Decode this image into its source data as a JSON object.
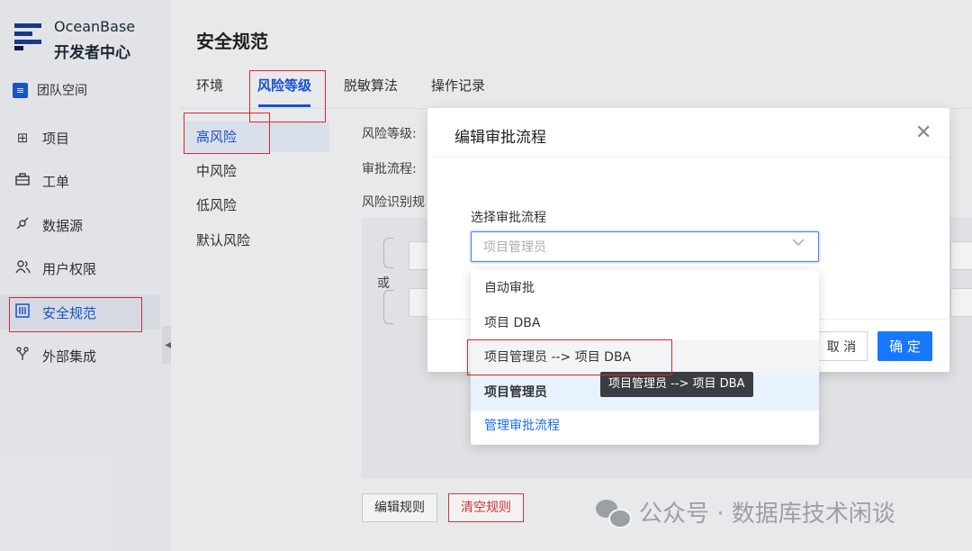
{
  "sidebar": {
    "brand_line1": "OceanBase",
    "brand_line2": "开发者中心",
    "team": "团队空间",
    "items": [
      {
        "label": "项目",
        "icon": "grid-icon"
      },
      {
        "label": "工单",
        "icon": "briefcase-icon"
      },
      {
        "label": "数据源",
        "icon": "plug-icon"
      },
      {
        "label": "用户权限",
        "icon": "users-icon"
      },
      {
        "label": "安全规范",
        "icon": "shield-icon",
        "active": true
      },
      {
        "label": "外部集成",
        "icon": "fork-icon"
      }
    ]
  },
  "page": {
    "title": "安全规范",
    "tabs": [
      "环境",
      "风险等级",
      "脱敏算法",
      "操作记录"
    ],
    "active_tab": "风险等级"
  },
  "risk_levels": [
    "高风险",
    "中风险",
    "低风险",
    "默认风险"
  ],
  "details": {
    "risk_level_label": "风险等级:",
    "approval_label": "审批流程:",
    "rules_label": "风险识别规",
    "or_label": "或",
    "edit_rules": "编辑规则",
    "clear_rules": "清空规则"
  },
  "modal": {
    "title": "编辑审批流程",
    "select_label": "选择审批流程",
    "select_value": "项目管理员",
    "cancel": "取 消",
    "ok": "确 定"
  },
  "dropdown": {
    "options": [
      "自动审批",
      "项目 DBA",
      "项目管理员 --> 项目 DBA",
      "项目管理员"
    ],
    "hovered": "项目管理员 --> 项目 DBA",
    "selected": "项目管理员",
    "footer_link": "管理审批流程",
    "tooltip": "项目管理员 --> 项目 DBA"
  },
  "watermark": "公众号 · 数据库技术闲谈",
  "colors": {
    "accent": "#1a56d6",
    "primary_button": "#1677ff",
    "danger": "#e0383e",
    "annotation": "#e0242c"
  }
}
